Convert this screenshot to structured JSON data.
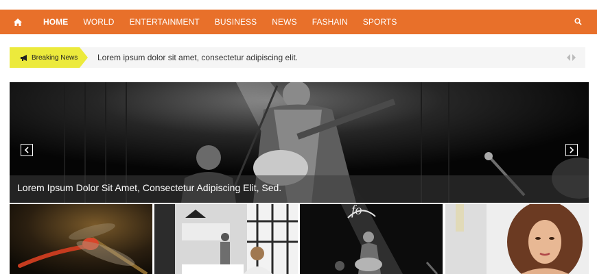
{
  "nav": {
    "home_icon": "home-icon",
    "items": [
      {
        "label": "HOME",
        "active": true
      },
      {
        "label": "WORLD"
      },
      {
        "label": "ENTERTAINMENT"
      },
      {
        "label": "BUSINESS"
      },
      {
        "label": "NEWS"
      },
      {
        "label": "FASHAIN"
      },
      {
        "label": "SPORTS"
      }
    ],
    "search_icon": "search-icon",
    "accent": "#e8702a"
  },
  "breaking": {
    "label": "Breaking News",
    "icon": "megaphone-icon",
    "text": "Lorem ipsum dolor sit amet, consectetur adipiscing elit.",
    "label_color": "#ecea3c"
  },
  "hero": {
    "caption": "Lorem Ipsum Dolor Sit Amet, Consectetur Adipiscing Elit, Sed.",
    "prev_icon": "chevron-left-icon",
    "next_icon": "chevron-right-icon"
  },
  "thumbnails": [
    {
      "name": "dragonfly"
    },
    {
      "name": "meeting"
    },
    {
      "name": "concert"
    },
    {
      "name": "portrait"
    }
  ]
}
